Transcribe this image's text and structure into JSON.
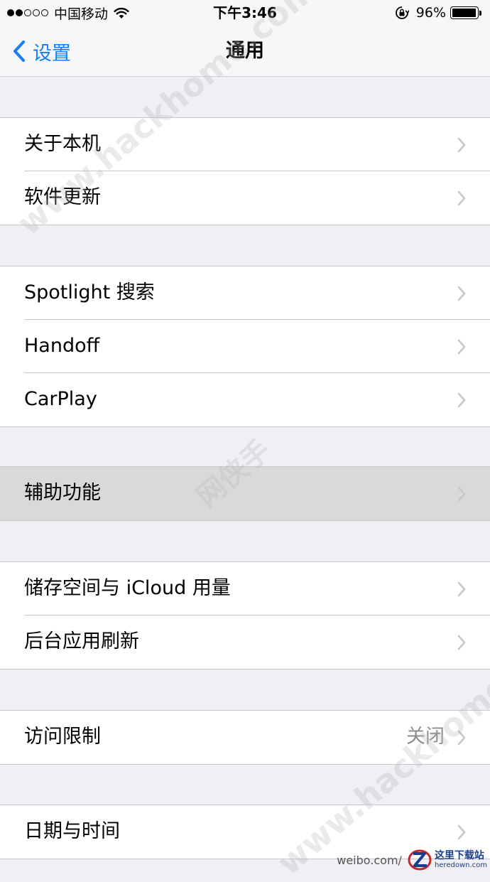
{
  "status_bar": {
    "carrier": "中国移动",
    "time": "下午3:46",
    "battery_percent": "96%",
    "battery_level": 0.96,
    "signal_bars_filled": 2,
    "signal_bars_total": 5
  },
  "nav": {
    "back_label": "设置",
    "title": "通用"
  },
  "groups": [
    {
      "rows": [
        {
          "label": "关于本机"
        },
        {
          "label": "软件更新"
        }
      ]
    },
    {
      "rows": [
        {
          "label": "Spotlight 搜索"
        },
        {
          "label": "Handoff"
        },
        {
          "label": "CarPlay"
        }
      ]
    },
    {
      "rows": [
        {
          "label": "辅助功能",
          "highlighted": true
        }
      ]
    },
    {
      "rows": [
        {
          "label": "储存空间与 iCloud 用量"
        },
        {
          "label": "后台应用刷新"
        }
      ]
    },
    {
      "rows": [
        {
          "label": "访问限制",
          "value": "关闭"
        }
      ]
    },
    {
      "rows": [
        {
          "label": "日期与时间"
        }
      ]
    }
  ],
  "watermarks": {
    "primary": "www.hackhome.com",
    "secondary": "网侠手",
    "weibo": "weibo.com/",
    "logo_cn": "这里下载站",
    "logo_en": "heredown.com"
  },
  "colors": {
    "accent": "#147efb",
    "background": "#efeff4",
    "highlight": "#d9d9d9",
    "secondary_text": "#8e8e93"
  }
}
